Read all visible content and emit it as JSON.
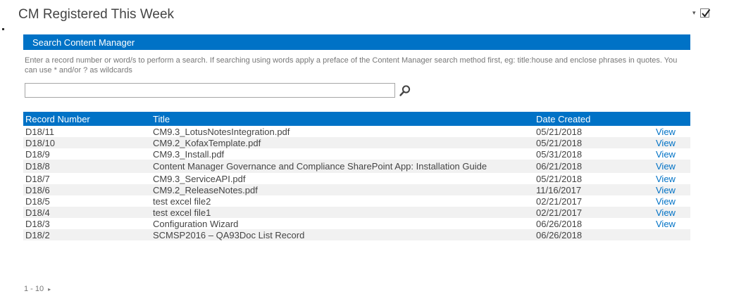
{
  "webpart": {
    "title": "CM Registered This Week",
    "menu_icon": "chevron-down-icon",
    "checkbox_checked": true
  },
  "search": {
    "header": "Search Content Manager",
    "instructions": "Enter a record number or word/s to perform a search. If searching using words apply a preface of the Content Manager search method first, eg: title:house and enclose phrases in quotes. You can use * and/or ? as wildcards",
    "value": "",
    "placeholder": "",
    "button_icon": "search-icon"
  },
  "table": {
    "columns": [
      "Record Number",
      "Title",
      "Date Created",
      ""
    ],
    "rows": [
      {
        "record_number": "D18/11",
        "title": "CM9.3_LotusNotesIntegration.pdf",
        "date_created": "05/21/2018",
        "action": "View"
      },
      {
        "record_number": "D18/10",
        "title": "CM9.2_KofaxTemplate.pdf",
        "date_created": "05/21/2018",
        "action": "View"
      },
      {
        "record_number": "D18/9",
        "title": "CM9.3_Install.pdf",
        "date_created": "05/31/2018",
        "action": "View"
      },
      {
        "record_number": "D18/8",
        "title": "Content Manager Governance and Compliance SharePoint App: Installation Guide",
        "date_created": "06/21/2018",
        "action": "View"
      },
      {
        "record_number": "D18/7",
        "title": "CM9.3_ServiceAPI.pdf",
        "date_created": "05/21/2018",
        "action": "View"
      },
      {
        "record_number": "D18/6",
        "title": "CM9.2_ReleaseNotes.pdf",
        "date_created": "11/16/2017",
        "action": "View"
      },
      {
        "record_number": "D18/5",
        "title": "test excel file2",
        "date_created": "02/21/2017",
        "action": "View"
      },
      {
        "record_number": "D18/4",
        "title": "test excel file1",
        "date_created": "02/21/2017",
        "action": "View"
      },
      {
        "record_number": "D18/3",
        "title": "Configuration Wizard",
        "date_created": "06/26/2018",
        "action": "View"
      },
      {
        "record_number": "D18/2",
        "title": "SCMSP2016 – QA93Doc List Record",
        "date_created": "06/26/2018",
        "action": ""
      }
    ]
  },
  "pager": {
    "range": "1 - 10",
    "next_icon": "triangle-right-icon"
  },
  "colors": {
    "accent": "#0072c6",
    "text": "#444444",
    "alt_row": "#f1f1f1"
  }
}
